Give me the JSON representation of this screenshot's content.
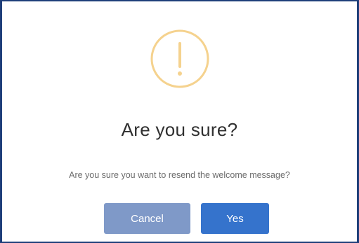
{
  "dialog": {
    "icon": "warning-exclamation-icon",
    "icon_color": "#f5d28e",
    "title": "Are you sure?",
    "message": "Are you sure you want to resend the welcome message?",
    "buttons": {
      "cancel_label": "Cancel",
      "yes_label": "Yes"
    },
    "colors": {
      "cancel_button": "#7f99c8",
      "yes_button": "#3573cc",
      "frame_border": "#1f3f7a"
    }
  }
}
